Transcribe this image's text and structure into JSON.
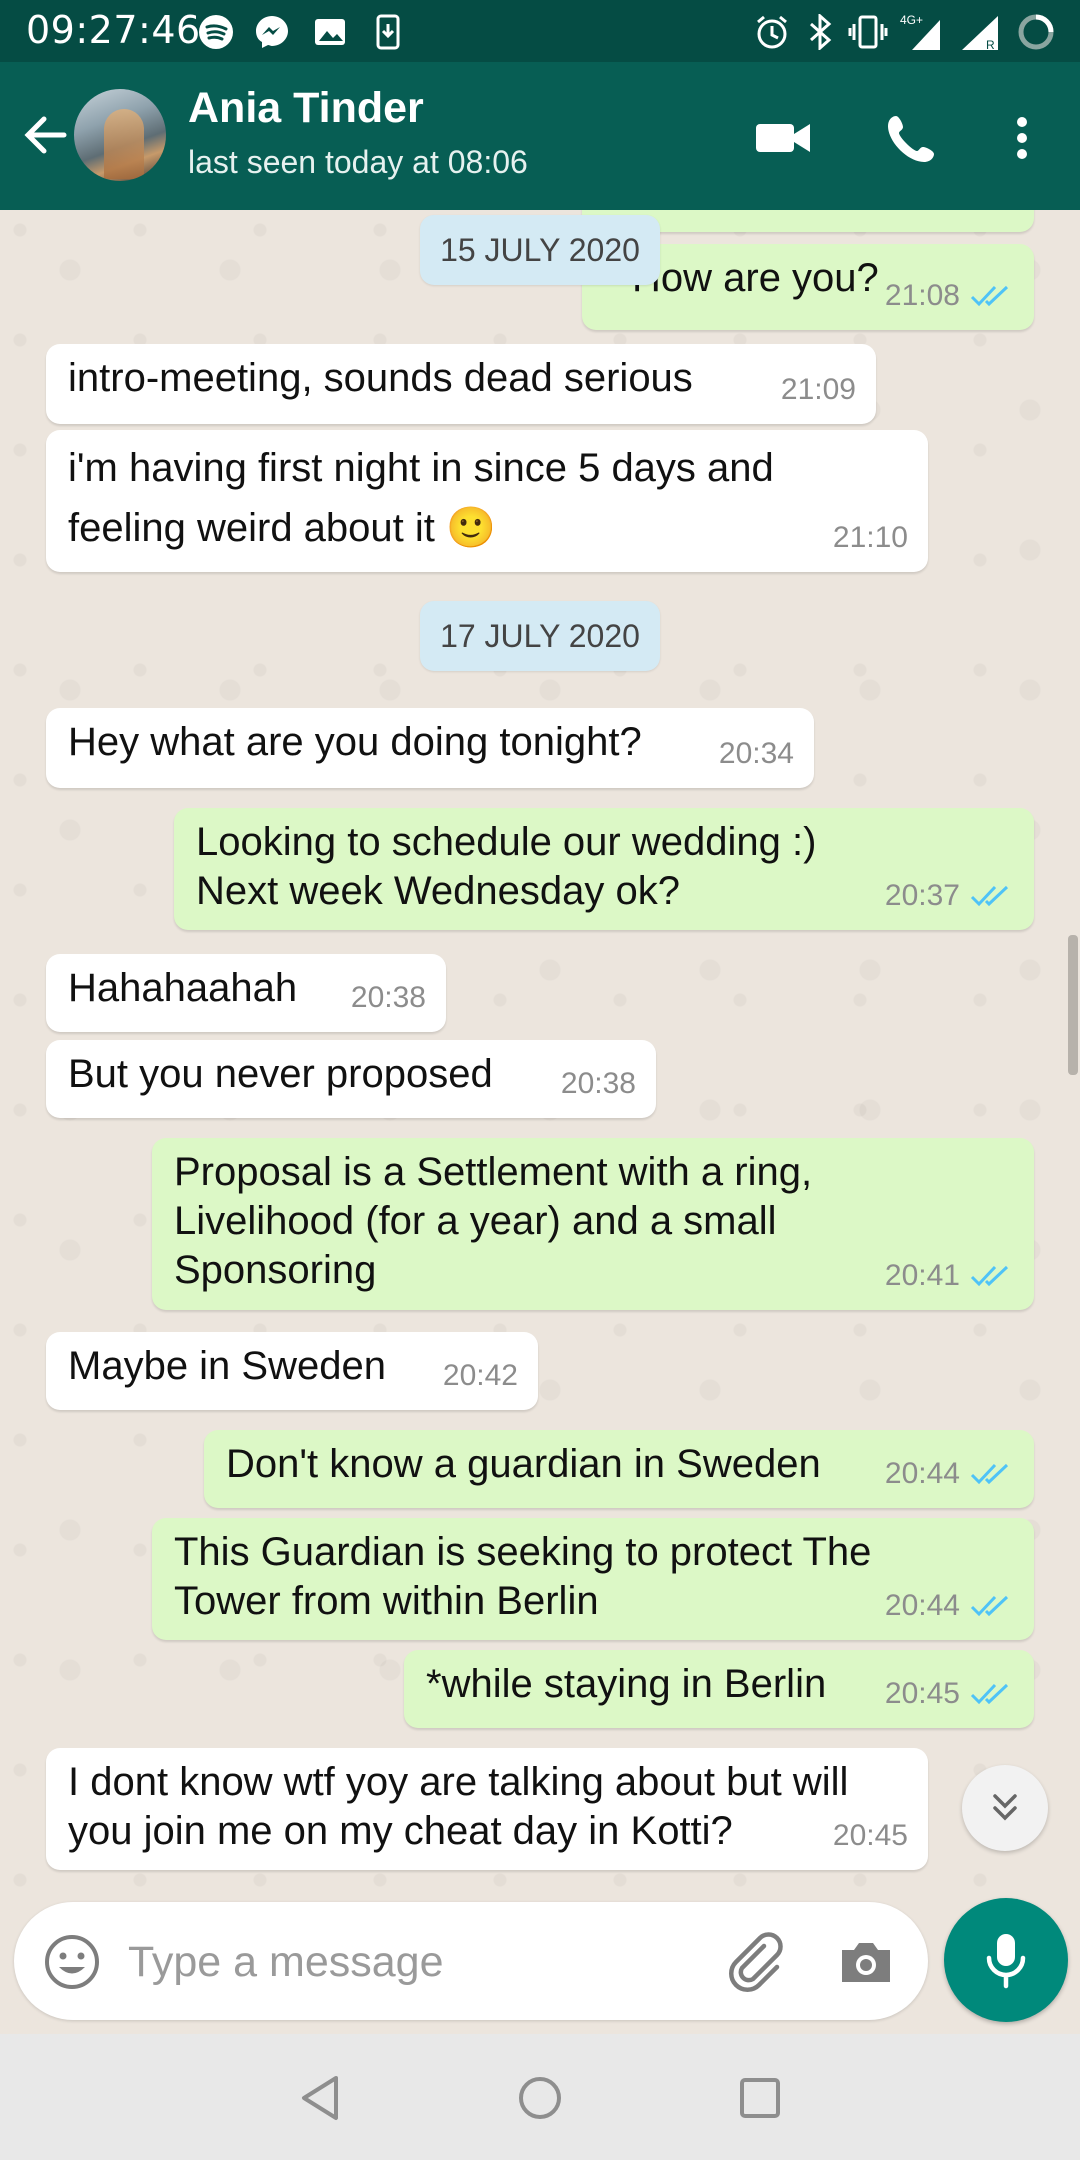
{
  "status_bar": {
    "time": "09:27:46",
    "network": "4G+"
  },
  "header": {
    "contact_name": "Ania Tinder",
    "last_seen": "last seen today at 08:06",
    "icons": [
      "back-arrow-icon",
      "video-call-icon",
      "voice-call-icon",
      "more-options-icon"
    ]
  },
  "chat": {
    "date_chips": [
      "15 JULY 2020",
      "17 JULY 2020"
    ],
    "messages": [
      {
        "dir": "out",
        "text": "How are you?",
        "time": "21:08",
        "ticks": "read"
      },
      {
        "dir": "in",
        "text": "intro-meeting, sounds dead serious",
        "time": "21:09"
      },
      {
        "dir": "in",
        "text": "i'm having first night in since 5 days and\nfeeling weird about it 🙂",
        "time": "21:10"
      },
      {
        "dir": "in",
        "text": "Hey what are you doing tonight?",
        "time": "20:34"
      },
      {
        "dir": "out",
        "text": "Looking to schedule our wedding :)\nNext week Wednesday ok?",
        "time": "20:37",
        "ticks": "read"
      },
      {
        "dir": "in",
        "text": "Hahahaahah",
        "time": "20:38"
      },
      {
        "dir": "in",
        "text": "But you never proposed",
        "time": "20:38"
      },
      {
        "dir": "out",
        "text": "Proposal is a Settlement with a ring,\nLivelihood (for a year) and a small\nSponsoring",
        "time": "20:41",
        "ticks": "read"
      },
      {
        "dir": "in",
        "text": "Maybe in Sweden",
        "time": "20:42"
      },
      {
        "dir": "out",
        "text": "Don't know a guardian in Sweden",
        "time": "20:44",
        "ticks": "read"
      },
      {
        "dir": "out",
        "text": "This Guardian is seeking to protect The\nTower from within Berlin",
        "time": "20:44",
        "ticks": "read"
      },
      {
        "dir": "out",
        "text": "*while staying in Berlin",
        "time": "20:45",
        "ticks": "read"
      },
      {
        "dir": "in",
        "text": "I dont know wtf yoy are talking about but will\nyou join me on my cheat day in Kotti?",
        "time": "20:45"
      }
    ]
  },
  "composer": {
    "placeholder": "Type a message",
    "value": ""
  },
  "colors": {
    "header": "#075e54",
    "status_bar": "#054c44",
    "outgoing_bubble": "#dcf8c6",
    "incoming_bubble": "#ffffff",
    "read_ticks": "#4fc3f7",
    "mic_button": "#00897b"
  }
}
